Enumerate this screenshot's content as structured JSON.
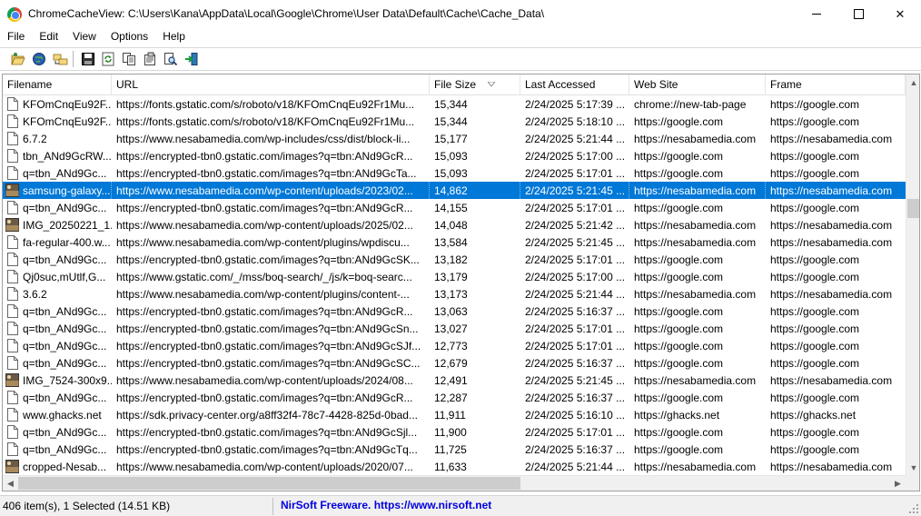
{
  "window": {
    "title": "ChromeCacheView:   C:\\Users\\Kana\\AppData\\Local\\Google\\Chrome\\User Data\\Default\\Cache\\Cache_Data\\",
    "minimize": "",
    "maximize": "",
    "close": "✕"
  },
  "menu": [
    "File",
    "Edit",
    "View",
    "Options",
    "Help"
  ],
  "toolbar": {
    "icons": [
      "open-folder-icon",
      "web-globe-icon",
      "folders-icon",
      "save-icon",
      "refresh-icon",
      "copy-icon",
      "properties-icon",
      "find-icon",
      "exit-icon"
    ]
  },
  "columns": [
    "Filename",
    "URL",
    "File Size",
    "Last Accessed",
    "Web Site",
    "Frame"
  ],
  "sort": {
    "column": "File Size",
    "direction": "descending"
  },
  "rows": [
    {
      "icon": "file",
      "filename": "KFOmCnqEu92F...",
      "url": "https://fonts.gstatic.com/s/roboto/v18/KFOmCnqEu92Fr1Mu...",
      "size": "15,344",
      "accessed": "2/24/2025 5:17:39 ...",
      "site": "chrome://new-tab-page",
      "frame": "https://google.com"
    },
    {
      "icon": "file",
      "filename": "KFOmCnqEu92F...",
      "url": "https://fonts.gstatic.com/s/roboto/v18/KFOmCnqEu92Fr1Mu...",
      "size": "15,344",
      "accessed": "2/24/2025 5:18:10 ...",
      "site": "https://google.com",
      "frame": "https://google.com"
    },
    {
      "icon": "file",
      "filename": "6.7.2",
      "url": "https://www.nesabamedia.com/wp-includes/css/dist/block-li...",
      "size": "15,177",
      "accessed": "2/24/2025 5:21:44 ...",
      "site": "https://nesabamedia.com",
      "frame": "https://nesabamedia.com"
    },
    {
      "icon": "file",
      "filename": "tbn_ANd9GcRW...",
      "url": "https://encrypted-tbn0.gstatic.com/images?q=tbn:ANd9GcR...",
      "size": "15,093",
      "accessed": "2/24/2025 5:17:00 ...",
      "site": "https://google.com",
      "frame": "https://google.com"
    },
    {
      "icon": "file",
      "filename": "q=tbn_ANd9Gc...",
      "url": "https://encrypted-tbn0.gstatic.com/images?q=tbn:ANd9GcTa...",
      "size": "15,093",
      "accessed": "2/24/2025 5:17:01 ...",
      "site": "https://google.com",
      "frame": "https://google.com"
    },
    {
      "icon": "image",
      "filename": "samsung-galaxy...",
      "url": "https://www.nesabamedia.com/wp-content/uploads/2023/02...",
      "size": "14,862",
      "accessed": "2/24/2025 5:21:45 ...",
      "site": "https://nesabamedia.com",
      "frame": "https://nesabamedia.com",
      "selected": true
    },
    {
      "icon": "file",
      "filename": "q=tbn_ANd9Gc...",
      "url": "https://encrypted-tbn0.gstatic.com/images?q=tbn:ANd9GcR...",
      "size": "14,155",
      "accessed": "2/24/2025 5:17:01 ...",
      "site": "https://google.com",
      "frame": "https://google.com"
    },
    {
      "icon": "image",
      "filename": "IMG_20250221_1...",
      "url": "https://www.nesabamedia.com/wp-content/uploads/2025/02...",
      "size": "14,048",
      "accessed": "2/24/2025 5:21:42 ...",
      "site": "https://nesabamedia.com",
      "frame": "https://nesabamedia.com"
    },
    {
      "icon": "file",
      "filename": "fa-regular-400.w...",
      "url": "https://www.nesabamedia.com/wp-content/plugins/wpdiscu...",
      "size": "13,584",
      "accessed": "2/24/2025 5:21:45 ...",
      "site": "https://nesabamedia.com",
      "frame": "https://nesabamedia.com"
    },
    {
      "icon": "file",
      "filename": "q=tbn_ANd9Gc...",
      "url": "https://encrypted-tbn0.gstatic.com/images?q=tbn:ANd9GcSK...",
      "size": "13,182",
      "accessed": "2/24/2025 5:17:01 ...",
      "site": "https://google.com",
      "frame": "https://google.com"
    },
    {
      "icon": "file",
      "filename": "Qj0suc,mUtlf,G...",
      "url": "https://www.gstatic.com/_/mss/boq-search/_/js/k=boq-searc...",
      "size": "13,179",
      "accessed": "2/24/2025 5:17:00 ...",
      "site": "https://google.com",
      "frame": "https://google.com"
    },
    {
      "icon": "file",
      "filename": "3.6.2",
      "url": "https://www.nesabamedia.com/wp-content/plugins/content-...",
      "size": "13,173",
      "accessed": "2/24/2025 5:21:44 ...",
      "site": "https://nesabamedia.com",
      "frame": "https://nesabamedia.com"
    },
    {
      "icon": "file",
      "filename": "q=tbn_ANd9Gc...",
      "url": "https://encrypted-tbn0.gstatic.com/images?q=tbn:ANd9GcR...",
      "size": "13,063",
      "accessed": "2/24/2025 5:16:37 ...",
      "site": "https://google.com",
      "frame": "https://google.com"
    },
    {
      "icon": "file",
      "filename": "q=tbn_ANd9Gc...",
      "url": "https://encrypted-tbn0.gstatic.com/images?q=tbn:ANd9GcSn...",
      "size": "13,027",
      "accessed": "2/24/2025 5:17:01 ...",
      "site": "https://google.com",
      "frame": "https://google.com"
    },
    {
      "icon": "file",
      "filename": "q=tbn_ANd9Gc...",
      "url": "https://encrypted-tbn0.gstatic.com/images?q=tbn:ANd9GcSJf...",
      "size": "12,773",
      "accessed": "2/24/2025 5:17:01 ...",
      "site": "https://google.com",
      "frame": "https://google.com"
    },
    {
      "icon": "file",
      "filename": "q=tbn_ANd9Gc...",
      "url": "https://encrypted-tbn0.gstatic.com/images?q=tbn:ANd9GcSC...",
      "size": "12,679",
      "accessed": "2/24/2025 5:16:37 ...",
      "site": "https://google.com",
      "frame": "https://google.com"
    },
    {
      "icon": "image",
      "filename": "IMG_7524-300x9...",
      "url": "https://www.nesabamedia.com/wp-content/uploads/2024/08...",
      "size": "12,491",
      "accessed": "2/24/2025 5:21:45 ...",
      "site": "https://nesabamedia.com",
      "frame": "https://nesabamedia.com"
    },
    {
      "icon": "file",
      "filename": "q=tbn_ANd9Gc...",
      "url": "https://encrypted-tbn0.gstatic.com/images?q=tbn:ANd9GcR...",
      "size": "12,287",
      "accessed": "2/24/2025 5:16:37 ...",
      "site": "https://google.com",
      "frame": "https://google.com"
    },
    {
      "icon": "file",
      "filename": "www.ghacks.net",
      "url": "https://sdk.privacy-center.org/a8ff32f4-78c7-4428-825d-0bad...",
      "size": "11,911",
      "accessed": "2/24/2025 5:16:10 ...",
      "site": "https://ghacks.net",
      "frame": "https://ghacks.net"
    },
    {
      "icon": "file",
      "filename": "q=tbn_ANd9Gc...",
      "url": "https://encrypted-tbn0.gstatic.com/images?q=tbn:ANd9GcSjl...",
      "size": "11,900",
      "accessed": "2/24/2025 5:17:01 ...",
      "site": "https://google.com",
      "frame": "https://google.com"
    },
    {
      "icon": "file",
      "filename": "q=tbn_ANd9Gc...",
      "url": "https://encrypted-tbn0.gstatic.com/images?q=tbn:ANd9GcTq...",
      "size": "11,725",
      "accessed": "2/24/2025 5:16:37 ...",
      "site": "https://google.com",
      "frame": "https://google.com"
    },
    {
      "icon": "image",
      "filename": "cropped-Nesab...",
      "url": "https://www.nesabamedia.com/wp-content/uploads/2020/07...",
      "size": "11,633",
      "accessed": "2/24/2025 5:21:44 ...",
      "site": "https://nesabamedia.com",
      "frame": "https://nesabamedia.com"
    }
  ],
  "status": {
    "count": "406 item(s), 1 Selected  (14.51 KB)",
    "link": "NirSoft Freeware. https://www.nirsoft.net"
  },
  "colors": {
    "selection": "#0078d7",
    "link": "#0000e0"
  }
}
